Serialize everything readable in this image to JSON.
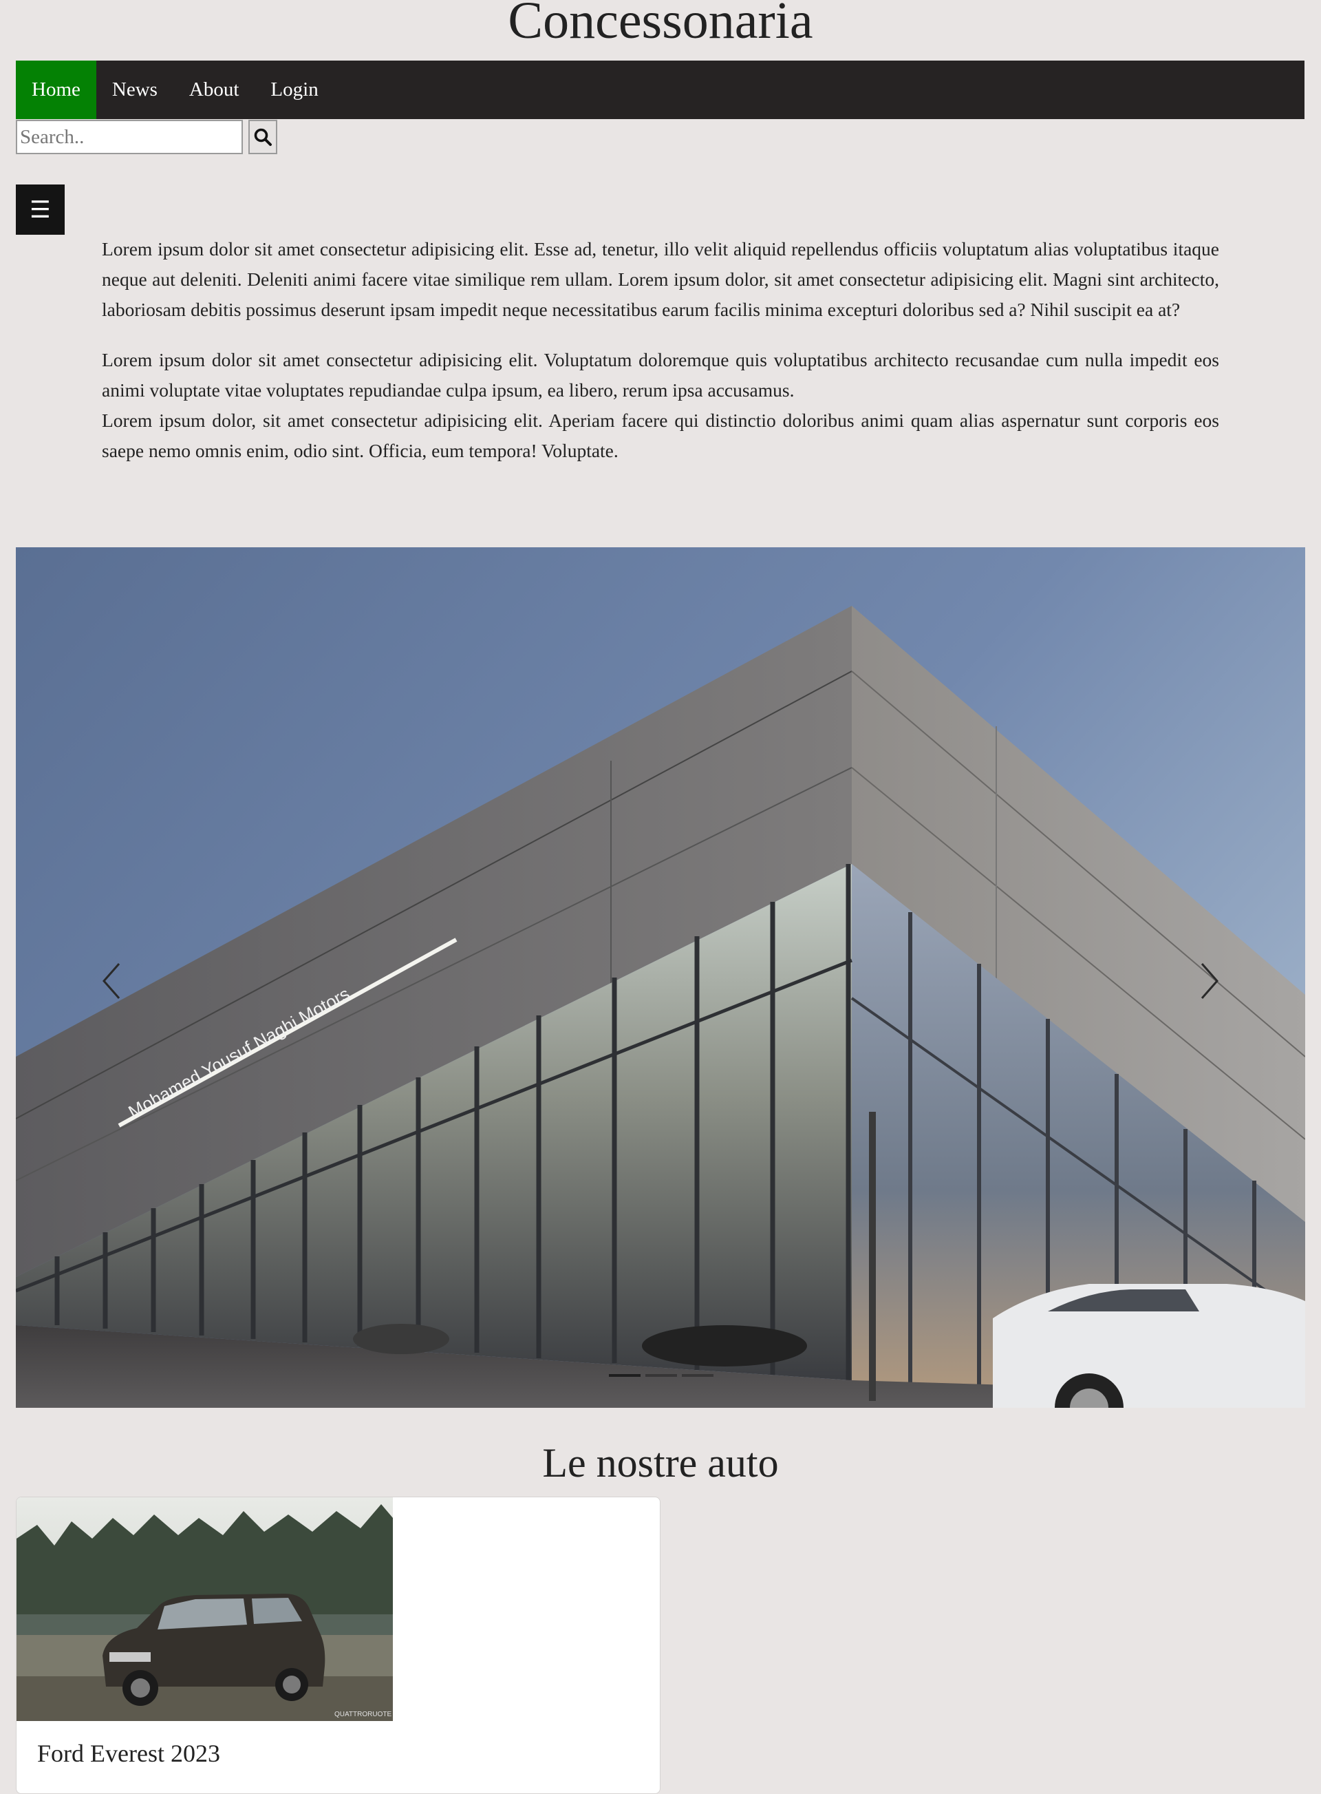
{
  "site": {
    "title": "Concessonaria"
  },
  "nav": {
    "items": [
      {
        "label": "Home",
        "active": true
      },
      {
        "label": "News",
        "active": false
      },
      {
        "label": "About",
        "active": false
      },
      {
        "label": "Login",
        "active": false
      }
    ]
  },
  "search": {
    "placeholder": "Search..",
    "icon": "search-icon"
  },
  "menu": {
    "icon": "☰"
  },
  "intro": {
    "paragraph1": "Lorem ipsum dolor sit amet consectetur adipisicing elit. Esse ad, tenetur, illo velit aliquid repellendus officiis voluptatum alias voluptatibus itaque neque aut deleniti. Deleniti animi facere vitae similique rem ullam. Lorem ipsum dolor, sit amet consectetur adipisicing elit. Magni sint architecto, laboriosam debitis possimus deserunt ipsam impedit neque necessitatibus earum facilis minima excepturi doloribus sed a? Nihil suscipit ea at?",
    "paragraph2a": "Lorem ipsum dolor sit amet consectetur adipisicing elit. Voluptatum doloremque quis voluptatibus architecto recusandae cum nulla impedit eos animi voluptate vitae voluptates repudiandae culpa ipsum, ea libero, rerum ipsa accusamus.",
    "paragraph2b": "Lorem ipsum dolor, sit amet consectetur adipisicing elit. Aperiam facere qui distinctio doloribus animi quam alias aspernatur sunt corporis eos saepe nemo omnis enim, odio sint. Officia, eum tempora! Voluptate."
  },
  "carousel": {
    "slide_count": 3,
    "active_index": 0,
    "storefront_sign": "Mohamed Yousuf Naghi Motors"
  },
  "cars_section": {
    "title": "Le nostre auto"
  },
  "cars": [
    {
      "name": "Ford Everest 2023",
      "watermark": "QUATTRORUOTE"
    }
  ],
  "colors": {
    "nav_bg": "#262323",
    "nav_active": "#048104",
    "page_bg": "#e9e5e4"
  }
}
